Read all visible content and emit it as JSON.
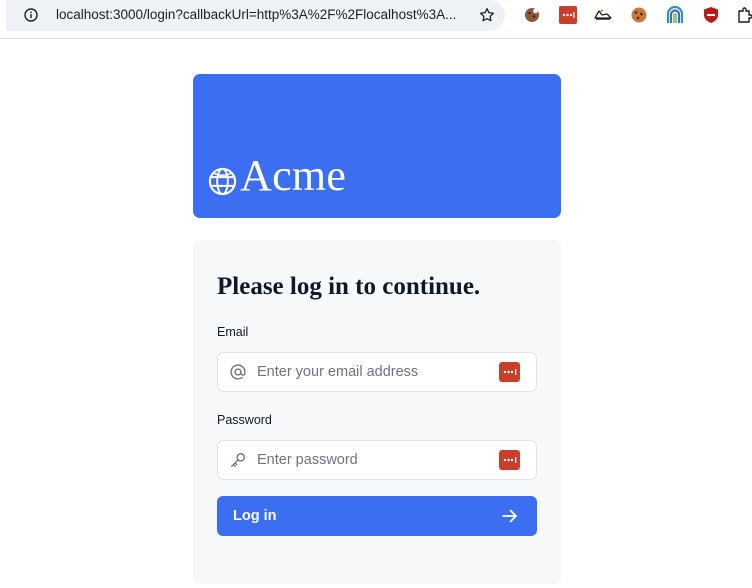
{
  "browser": {
    "url": "localhost:3000/login?callbackUrl=http%3A%2F%2Flocalhost%3A...",
    "icons": [
      "info-icon",
      "star-icon"
    ],
    "extensions": [
      "cookie-icon",
      "password-manager-icon",
      "shoe-icon",
      "cookie-icon",
      "rainbow-icon",
      "shield-icon",
      "puzzle-icon"
    ]
  },
  "hero": {
    "brand": "Acme",
    "icon": "globe-icon",
    "background": "#3b6ef0"
  },
  "form": {
    "title": "Please log in to continue.",
    "email": {
      "label": "Email",
      "placeholder": "Enter your email address",
      "icon": "at-icon"
    },
    "password": {
      "label": "Password",
      "placeholder": "Enter password",
      "icon": "key-icon"
    },
    "submit": {
      "label": "Log in",
      "icon": "arrow-right-icon"
    },
    "accent": "#3b6ef0"
  }
}
